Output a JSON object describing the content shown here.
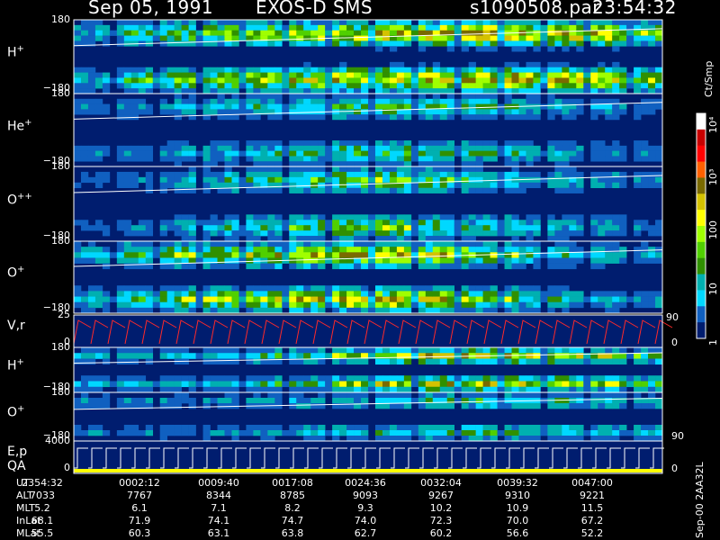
{
  "header": {
    "date": "Sep 05, 1991",
    "instrument": "EXOS-D SMS",
    "file": "s1090508.par",
    "time": "23:54:32"
  },
  "colors": {
    "background": "#000000",
    "bg_panel": "#001d6f",
    "trace_red": "#ff2a2a",
    "trace_white": "#ffffff",
    "qa_bar": "#ffff00"
  },
  "colorbar": {
    "unit": "Ct/Smp",
    "labels": [
      "10⁴",
      "10³",
      "100",
      "10",
      "1"
    ],
    "colors": [
      "#ffffff",
      "#c80000",
      "#ff0000",
      "#ff6000",
      "#7a6a00",
      "#d4c200",
      "#ffff00",
      "#a0ff00",
      "#50d000",
      "#309000",
      "#00b0b0",
      "#00d8ff",
      "#1060c0",
      "#001d6f"
    ]
  },
  "side_note": "Sep-00  2AA32L",
  "chart_data": {
    "type": "heatmap",
    "title": "Sep 05, 1991   EXOS-D SMS",
    "panels": [
      {
        "name": "H⁺",
        "label": "H",
        "sup": "+",
        "ytop": "180",
        "ybot": "−180",
        "intensity": [
          0.3,
          0.5,
          0.55,
          0.7,
          0.75,
          0.8,
          0.85,
          0.9,
          0.95,
          0.9,
          0.85,
          0.6
        ]
      },
      {
        "name": "He⁺",
        "label": "He",
        "sup": "+",
        "ytop": "180",
        "ybot": "−180",
        "intensity": [
          0.2,
          0.2,
          0.3,
          0.35,
          0.4,
          0.45,
          0.5,
          0.45,
          0.4,
          0.3,
          0.25,
          0.2
        ]
      },
      {
        "name": "O⁺⁺",
        "label": "O",
        "sup": "++",
        "ytop": "180",
        "ybot": "−180",
        "intensity": [
          0.15,
          0.2,
          0.3,
          0.4,
          0.5,
          0.55,
          0.6,
          0.5,
          0.4,
          0.3,
          0.25,
          0.2
        ]
      },
      {
        "name": "O⁺",
        "label": "O",
        "sup": "+",
        "ytop": "180",
        "ybot": "−180",
        "intensity": [
          0.3,
          0.5,
          0.6,
          0.65,
          0.8,
          0.85,
          0.85,
          0.75,
          0.6,
          0.4,
          0.3,
          0.25
        ]
      },
      {
        "name": "V,r",
        "label": "V,r",
        "sup": "",
        "ytop": "25",
        "ybot": "0",
        "right_top": "90",
        "right_bot": "0"
      },
      {
        "name": "H⁺",
        "label": "H",
        "sup": "+",
        "ytop": "180",
        "ybot": "−180",
        "intensity": [
          0.3,
          0.3,
          0.3,
          0.35,
          0.4,
          0.6,
          0.7,
          0.75,
          0.8,
          0.7,
          0.65,
          0.5
        ]
      },
      {
        "name": "O⁺",
        "label": "O",
        "sup": "+",
        "ytop": "180",
        "ybot": "−180",
        "intensity": [
          0.2,
          0.2,
          0.2,
          0.25,
          0.3,
          0.3,
          0.35,
          0.4,
          0.45,
          0.4,
          0.35,
          0.3
        ],
        "right_bot": "90"
      },
      {
        "name": "E,p QA",
        "label": "E,p",
        "sup": "",
        "label2": "QA",
        "ytop": "4000",
        "ybot": "0",
        "right_bot": "0"
      }
    ],
    "x_axis": {
      "row_labels": [
        "UT",
        "ALT",
        "MLT",
        "InLat",
        "MLat"
      ],
      "columns": [
        {
          "UT": "2354:32",
          "ALT": "7033",
          "MLT": "5.2",
          "InLat": "68.1",
          "MLat": "55.5"
        },
        {
          "UT": "0002:12",
          "ALT": "7767",
          "MLT": "6.1",
          "InLat": "71.9",
          "MLat": "60.3"
        },
        {
          "UT": "0009:40",
          "ALT": "8344",
          "MLT": "7.1",
          "InLat": "74.1",
          "MLat": "63.1"
        },
        {
          "UT": "0017:08",
          "ALT": "8785",
          "MLT": "8.2",
          "InLat": "74.7",
          "MLat": "63.8"
        },
        {
          "UT": "0024:36",
          "ALT": "9093",
          "MLT": "9.3",
          "InLat": "74.0",
          "MLat": "62.7"
        },
        {
          "UT": "0032:04",
          "ALT": "9267",
          "MLT": "10.2",
          "InLat": "72.3",
          "MLat": "60.2"
        },
        {
          "UT": "0039:32",
          "ALT": "9310",
          "MLT": "10.9",
          "InLat": "70.0",
          "MLat": "56.6"
        },
        {
          "UT": "0047:00",
          "ALT": "9221",
          "MLT": "11.5",
          "InLat": "67.2",
          "MLat": "52.2"
        }
      ]
    }
  }
}
